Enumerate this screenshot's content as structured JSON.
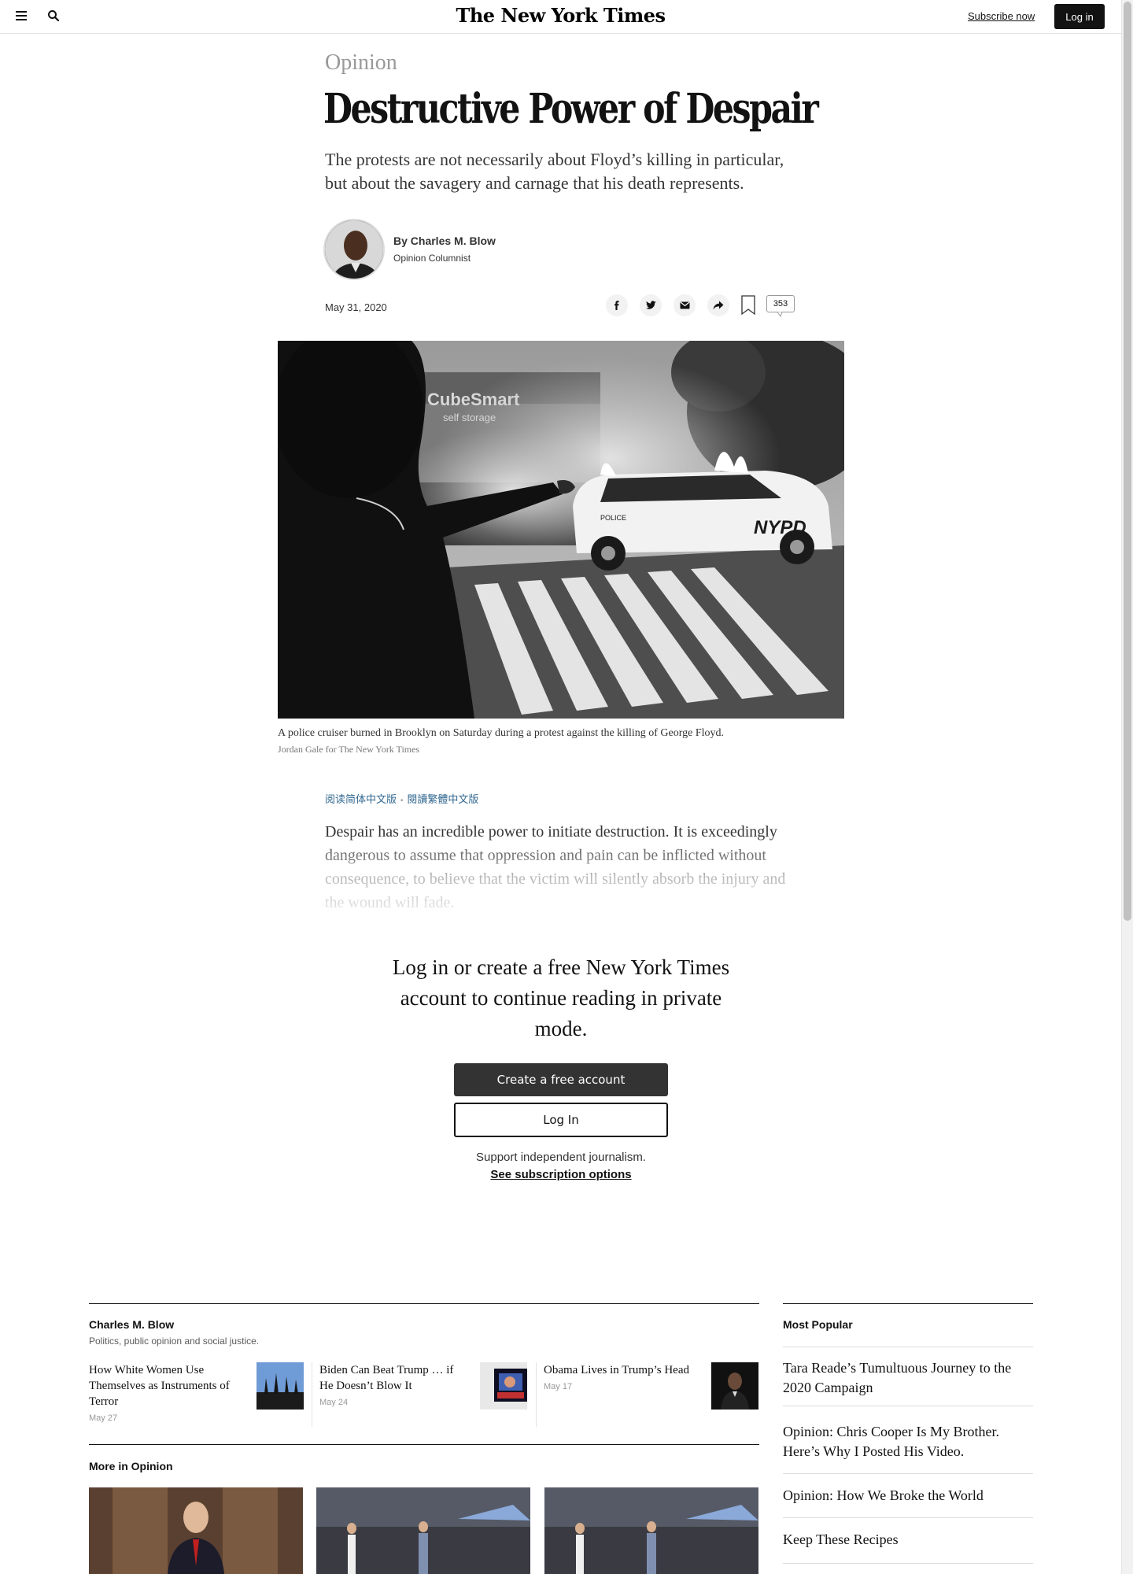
{
  "header": {
    "logo": "The New York Times",
    "subscribe_label": "Subscribe now",
    "login_label": "Log in"
  },
  "article": {
    "section": "Opinion",
    "headline": "Destructive Power of Despair",
    "summary": "The protests are not necessarily about Floyd’s killing in particular, but about the savagery and carnage that his death represents.",
    "byline": "By Charles M. Blow",
    "role": "Opinion Columnist",
    "date": "May 31, 2020",
    "comment_count": "353",
    "caption": "A police cruiser burned in Brooklyn on Saturday during a protest against the killing of George Floyd.",
    "credit": "Jordan Gale for The New York Times",
    "hero_sign": "CubeSmart",
    "hero_sign_sub": "self storage",
    "hero_car_text": "NYPD",
    "hero_car_police": "POLICE",
    "lang_simplified": "阅读简体中文版",
    "lang_traditional": "閱讀繁體中文版",
    "body": "Despair has an incredible power to initiate destruction. It is exceedingly dangerous to assume that oppression and pain can be inflicted without consequence, to believe that the victim will silently absorb the injury and the wound will fade."
  },
  "gateway": {
    "heading": "Log in or create a free New York Times account to continue reading in private mode.",
    "create_label": "Create a free account",
    "login_label": "Log In",
    "support_text": "Support independent journalism.",
    "options_label": "See subscription options"
  },
  "author_module": {
    "name": "Charles M. Blow",
    "description": "Politics, public opinion and social justice.",
    "stories": [
      {
        "title": "How White Women Use Themselves as Instruments of Terror",
        "date": "May 27"
      },
      {
        "title": "Biden Can Beat Trump … if He Doesn’t Blow It",
        "date": "May 24"
      },
      {
        "title": "Obama Lives in Trump’s Head",
        "date": "May 17"
      }
    ]
  },
  "more_in_opinion": {
    "label": "More in Opinion"
  },
  "most_popular": {
    "label": "Most Popular",
    "items": [
      "Tara Reade’s Tumultuous Journey to the 2020 Campaign",
      "Opinion: Chris Cooper Is My Brother. Here’s Why I Posted His Video.",
      "Opinion: How We Broke the World",
      "Keep These Recipes"
    ]
  },
  "icons": {
    "menu": "hamburger-menu-icon",
    "search": "search-icon",
    "facebook": "facebook-icon",
    "twitter": "twitter-icon",
    "email": "email-icon",
    "share": "share-arrow-icon",
    "bookmark": "bookmark-icon",
    "comments": "comment-bubble-icon"
  },
  "colors": {
    "link_blue": "#326891",
    "button_dark": "#333333",
    "section_gray": "#999999"
  }
}
